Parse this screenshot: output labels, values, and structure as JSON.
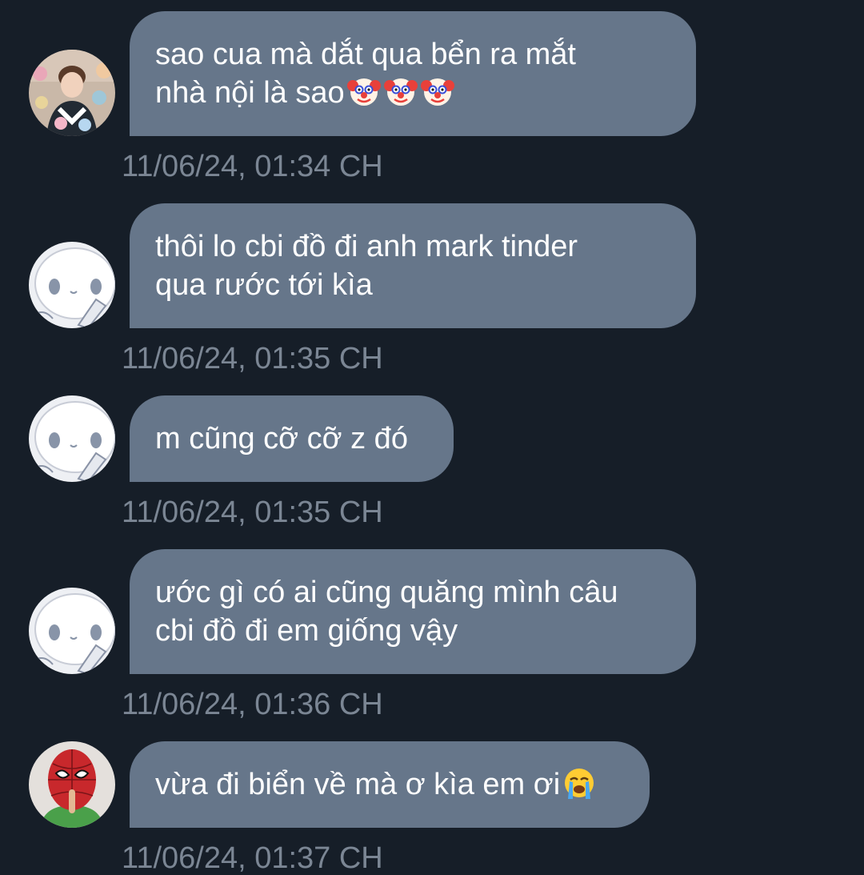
{
  "messages": [
    {
      "sender_avatar": "user-photo-avatar",
      "text": "sao cua mà dắt qua bển ra mắt\nnhà nội là sao",
      "emojis": [
        "clown-face-emoji",
        "clown-face-emoji",
        "clown-face-emoji"
      ],
      "timestamp": "11/06/24, 01:34 CH"
    },
    {
      "sender_avatar": "white-cartoon-avatar",
      "text": "thôi lo cbi đồ đi anh mark tinder\nqua rước tới kìa",
      "emojis": [],
      "timestamp": "11/06/24, 01:35 CH"
    },
    {
      "sender_avatar": "white-cartoon-avatar",
      "text": "m cũng cỡ cỡ z đó",
      "emojis": [],
      "timestamp": "11/06/24, 01:35 CH"
    },
    {
      "sender_avatar": "white-cartoon-avatar",
      "text": "ước gì có ai cũng quăng mình câu\ncbi đồ đi em giống vậy",
      "emojis": [],
      "timestamp": "11/06/24, 01:36 CH"
    },
    {
      "sender_avatar": "spider-mask-avatar",
      "text": "vừa đi biển về mà ơ kìa em ơi",
      "emojis": [
        "loudly-crying-face-emoji"
      ],
      "timestamp": "11/06/24, 01:37 CH"
    }
  ],
  "colors": {
    "background": "#161e28",
    "bubble": "#66768a",
    "timestamp": "#7b8694",
    "text": "#ffffff"
  }
}
